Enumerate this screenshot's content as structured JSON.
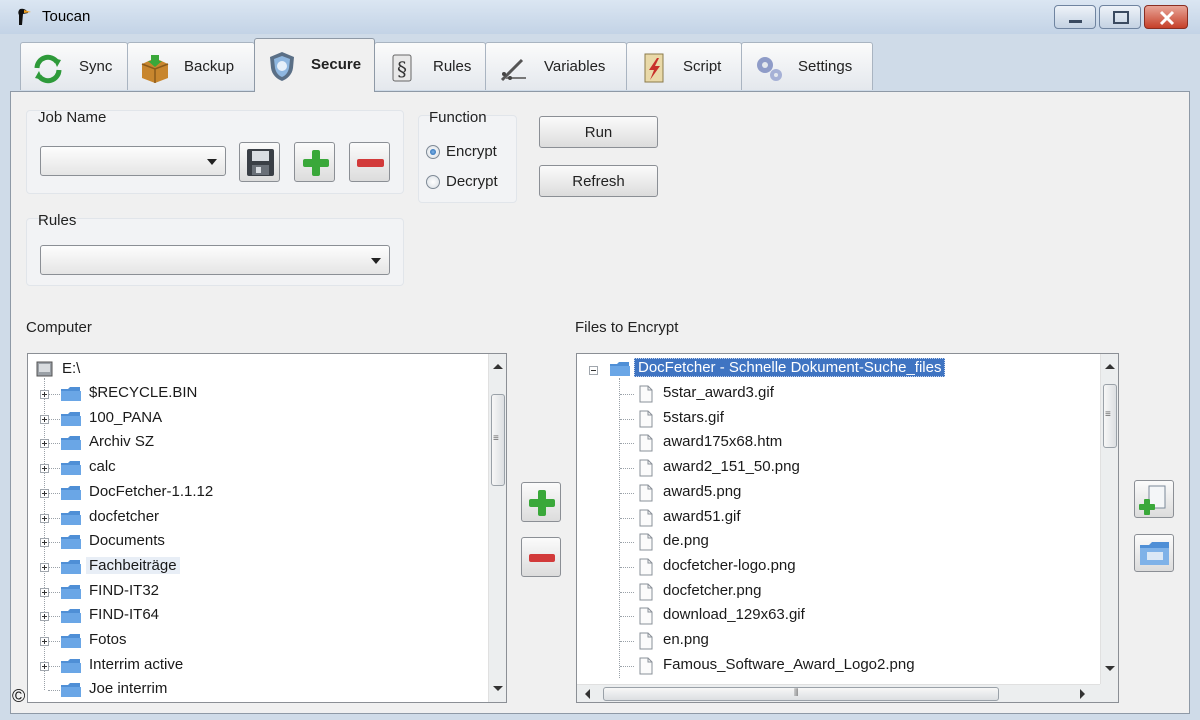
{
  "window": {
    "title": "Toucan"
  },
  "tabs": [
    {
      "label": "Sync",
      "icon": "sync-icon"
    },
    {
      "label": "Backup",
      "icon": "backup-box-icon"
    },
    {
      "label": "Secure",
      "icon": "shield-icon",
      "active": true
    },
    {
      "label": "Rules",
      "icon": "rules-scroll-icon"
    },
    {
      "label": "Variables",
      "icon": "variables-icon"
    },
    {
      "label": "Script",
      "icon": "script-icon"
    },
    {
      "label": "Settings",
      "icon": "gears-icon"
    }
  ],
  "job": {
    "label": "Job Name",
    "value": ""
  },
  "function": {
    "label": "Function",
    "options": [
      "Encrypt",
      "Decrypt"
    ],
    "selected": "Encrypt"
  },
  "actions": {
    "run": "Run",
    "refresh": "Refresh"
  },
  "rules": {
    "label": "Rules",
    "value": ""
  },
  "computer": {
    "label": "Computer",
    "root": "E:\\",
    "items": [
      "$RECYCLE.BIN",
      "100_PANA",
      "Archiv SZ",
      "calc",
      "DocFetcher-1.1.12",
      "docfetcher",
      "Documents",
      "Fachbeiträge",
      "FIND-IT32",
      "FIND-IT64",
      "Fotos",
      "Interrim active",
      "Joe interrim"
    ],
    "hovered": "Fachbeiträge"
  },
  "files": {
    "label": "Files to Encrypt",
    "root": "DocFetcher - Schnelle Dokument-Suche_files",
    "items": [
      "5star_award3.gif",
      "5stars.gif",
      "award175x68.htm",
      "award2_151_50.png",
      "award5.png",
      "award51.gif",
      "de.png",
      "docfetcher-logo.png",
      "docfetcher.png",
      "download_129x63.gif",
      "en.png",
      "Famous_Software_Award_Logo2.png"
    ]
  },
  "copyright": "©",
  "colors": {
    "selection": "#3f74c2",
    "folder": "#4f8fd6",
    "add_green": "#3aa83a",
    "remove_red": "#d23a3a"
  }
}
